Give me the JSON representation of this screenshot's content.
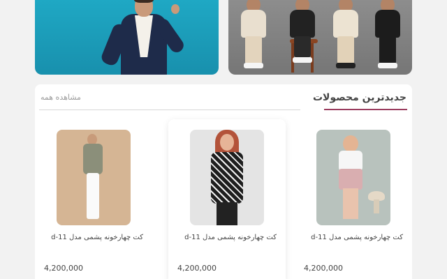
{
  "banners": {
    "men": {
      "title": ""
    },
    "kids": {
      "title": ""
    }
  },
  "products_section": {
    "title": "جدیدترین محصولات",
    "view_all": "مشاهده همه",
    "accent_color": "#9a3c5e",
    "items": [
      {
        "name": "کت چهارخونه پشمی مدل d-11",
        "price": "4,200,000"
      },
      {
        "name": "کت چهارخونه پشمی مدل d-11",
        "price": "4,200,000"
      },
      {
        "name": "کت چهارخونه پشمی مدل d-11",
        "price": "4,200,000"
      }
    ]
  }
}
